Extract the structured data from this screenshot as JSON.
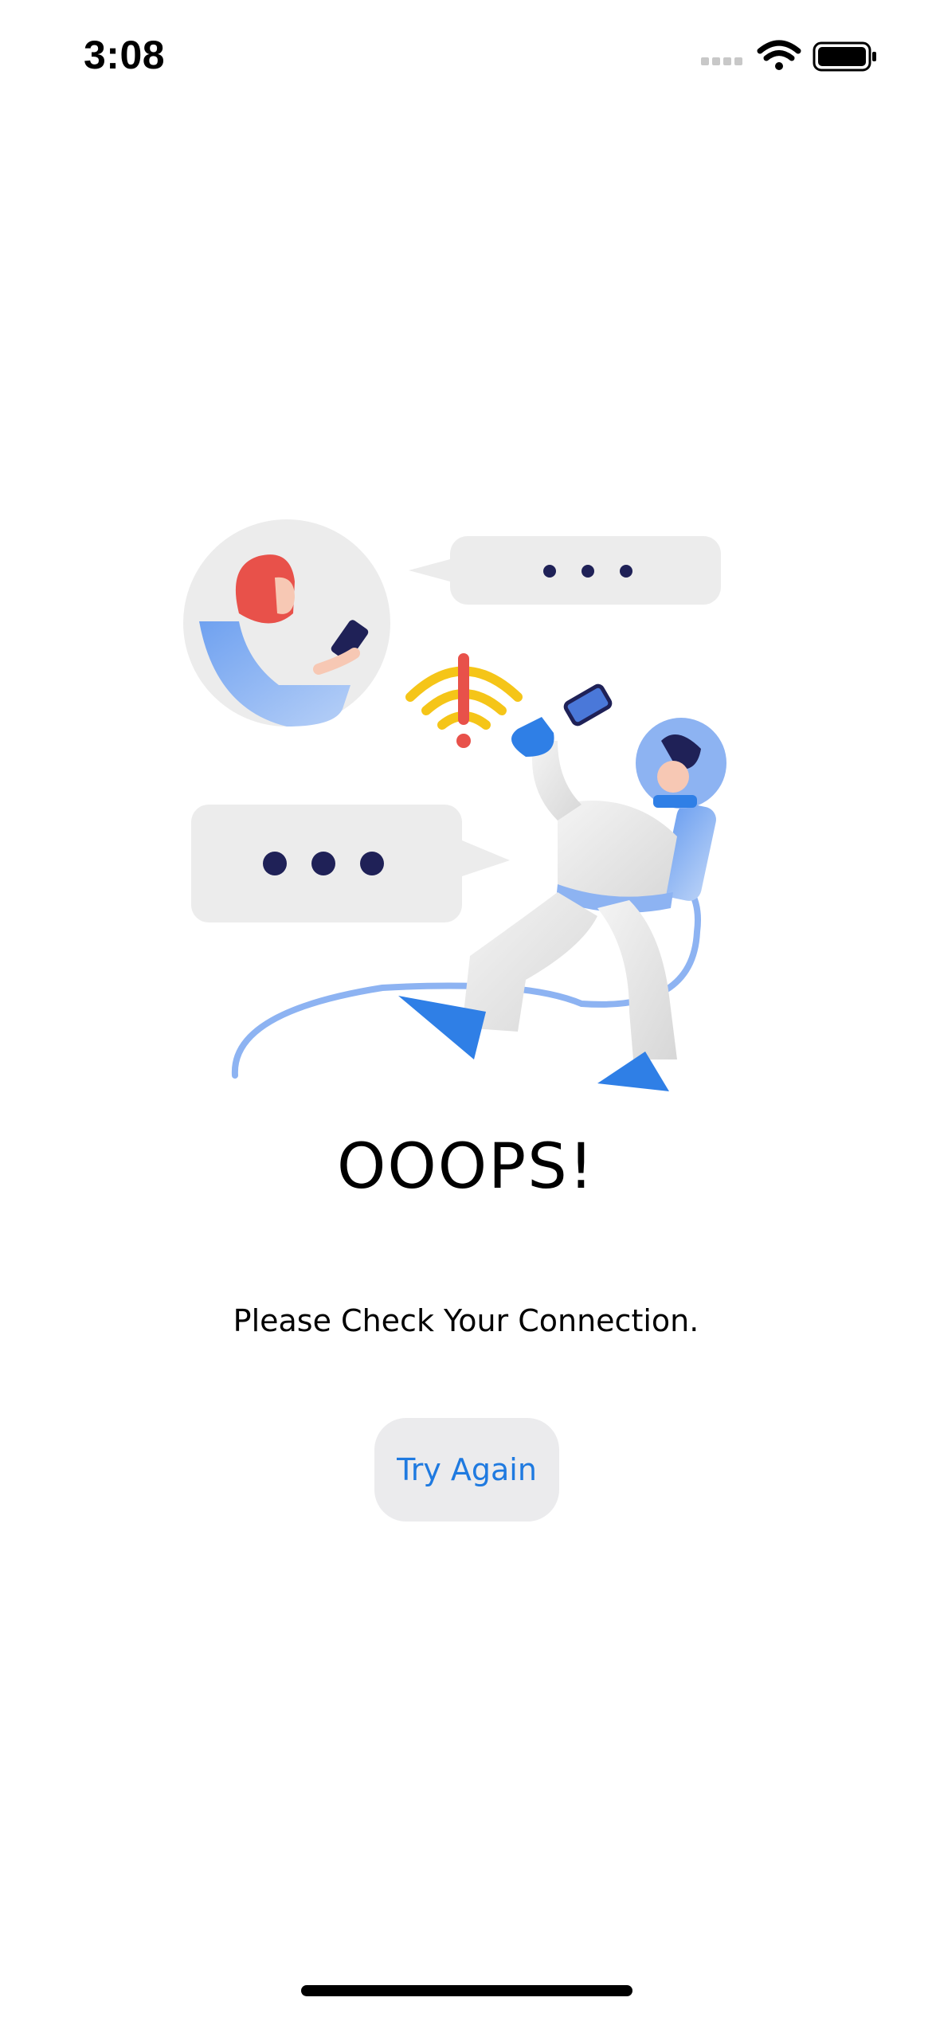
{
  "status_bar": {
    "time": "3:08",
    "icons": [
      "signal-icon",
      "wifi-icon",
      "battery-icon"
    ]
  },
  "error": {
    "title": "OOOPS!",
    "message": "Please Check Your Connection.",
    "button_label": "Try Again"
  },
  "illustration": {
    "name": "astronaut-no-connection",
    "warning_color": "#f5c518",
    "accent_color": "#2f7fe6"
  },
  "colors": {
    "button_background": "#ebebed",
    "button_text": "#1f7ae0"
  }
}
